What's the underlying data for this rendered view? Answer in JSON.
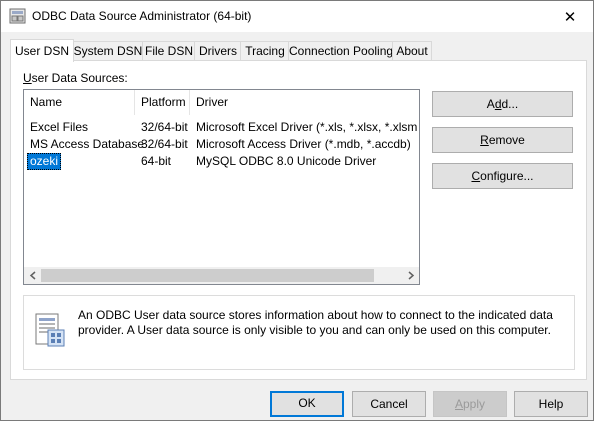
{
  "window": {
    "title": "ODBC Data Source Administrator (64-bit)",
    "close_glyph": "✕"
  },
  "tabs": [
    {
      "label": "User DSN"
    },
    {
      "label": "System DSN"
    },
    {
      "label": "File DSN"
    },
    {
      "label": "Drivers"
    },
    {
      "label": "Tracing"
    },
    {
      "label": "Connection Pooling"
    },
    {
      "label": "About"
    }
  ],
  "panel": {
    "label_pre": "",
    "label_accel": "U",
    "label_post": "ser Data Sources:"
  },
  "list": {
    "columns": [
      "Name",
      "Platform",
      "Driver"
    ],
    "rows": [
      {
        "name": "Excel Files",
        "platform": "32/64-bit",
        "driver": "Microsoft Excel Driver (*.xls, *.xlsx, *.xlsm, *.xlsb)"
      },
      {
        "name": "MS Access Database",
        "platform": "32/64-bit",
        "driver": "Microsoft Access Driver (*.mdb, *.accdb)"
      },
      {
        "name": "ozeki",
        "platform": "64-bit",
        "driver": "MySQL ODBC 8.0 Unicode Driver"
      }
    ],
    "selected_row": 2
  },
  "buttons": {
    "add": {
      "pre": "A",
      "accel": "d",
      "post": "d..."
    },
    "remove": {
      "pre": "",
      "accel": "R",
      "post": "emove"
    },
    "configure": {
      "pre": "",
      "accel": "C",
      "post": "onfigure..."
    }
  },
  "info": {
    "text": "An ODBC User data source stores information about how to connect to the indicated data provider.   A User data source is only visible to you and can only be used on this computer."
  },
  "footer": {
    "ok": "OK",
    "cancel": "Cancel",
    "apply_accel": "A",
    "apply_post": "pply",
    "help": "Help"
  },
  "colors": {
    "accent": "#0078d7",
    "window_bg": "#f0f0f0"
  }
}
